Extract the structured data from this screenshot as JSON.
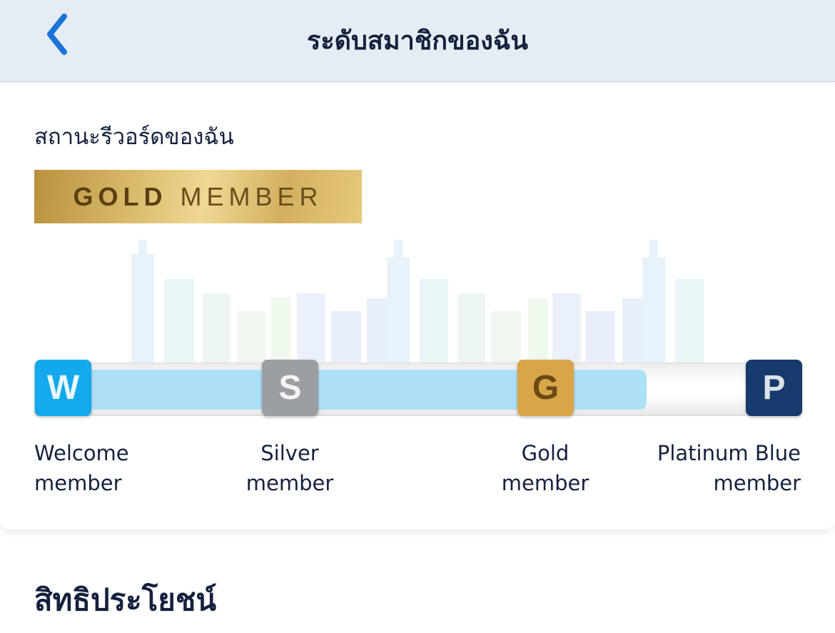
{
  "header": {
    "title": "ระดับสมาชิกของฉัน",
    "back_icon": "chevron-left-icon"
  },
  "status": {
    "label": "สถานะรีวอร์ดของฉัน",
    "tier_banner": {
      "bold": "GOLD",
      "light": "MEMBER"
    }
  },
  "progress": {
    "current_tier": "Gold",
    "progress_fraction": 0.8,
    "tiers": [
      {
        "letter": "W",
        "line1": "Welcome",
        "line2": "member",
        "color": "#13a9ec"
      },
      {
        "letter": "S",
        "line1": "Silver",
        "line2": "member",
        "color": "#9b9ea3"
      },
      {
        "letter": "G",
        "line1": "Gold",
        "line2": "member",
        "color": "#d9a548"
      },
      {
        "letter": "P",
        "line1": "Platinum Blue",
        "line2": "member",
        "color": "#153a6b"
      }
    ]
  },
  "benefits": {
    "title": "สิทธิประโยชน์"
  },
  "colors": {
    "header_bg": "#e5ecf3",
    "accent_blue": "#1a73d9",
    "progress_fill": "#aee0f8",
    "text": "#14213d"
  }
}
